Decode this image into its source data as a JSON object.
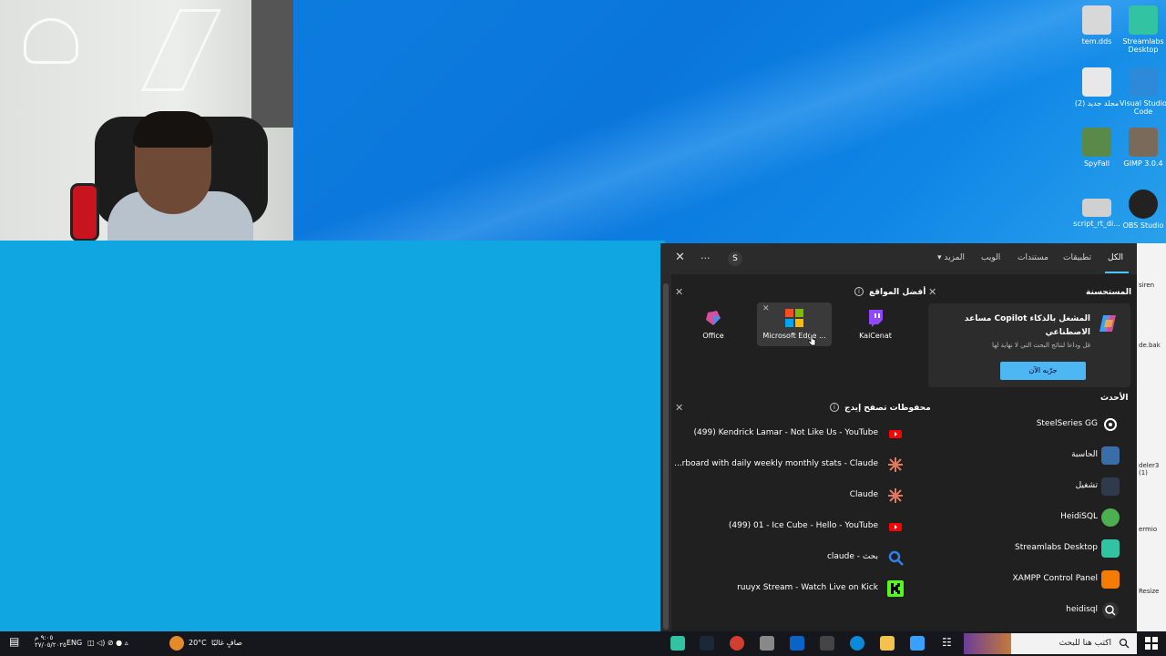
{
  "desktop_icons": [
    {
      "label": "tem.dds",
      "color": "#d8d8d8"
    },
    {
      "label": "Streamlabs Desktop",
      "color": "#31c3a2"
    },
    {
      "label": "مجلد جديد (2)",
      "color": "#e8e8e8"
    },
    {
      "label": "Visual Studio Code",
      "color": "#2c8ad9"
    },
    {
      "label": "SpyFall",
      "color": "#5a8a4a"
    },
    {
      "label": "GIMP 3.0.4",
      "color": "#7a6a5a"
    },
    {
      "label": "script_rt_di...",
      "color": "#d0d0d0"
    },
    {
      "label": "OBS Studio",
      "color": "#222222"
    }
  ],
  "right_strip_labels": [
    "siren",
    "de.bak",
    "deler3 (1)",
    "ermio",
    "Resize"
  ],
  "search": {
    "tabs": [
      "الكل",
      "تطبيقات",
      "مستندات",
      "الويب",
      "المزيد"
    ],
    "avatar_letter": "S",
    "more_label": "···",
    "close_label": "✕",
    "top_sites_title": "أفضل المواقع",
    "top_sites": [
      {
        "label": "Office",
        "icon": "office-icon"
      },
      {
        "label": "Microsoft Edge ...",
        "icon": "microsoft-icon"
      },
      {
        "label": "KaiCenat",
        "icon": "twitch-icon"
      }
    ],
    "history_title": "محفوظات تصفح إيدج",
    "history": [
      {
        "label": "(499) Kendrick Lamar - Not Like Us - YouTube",
        "icon": "youtube-icon"
      },
      {
        "label": "...rboard with daily weekly monthly stats - Claude",
        "icon": "claude-icon"
      },
      {
        "label": "Claude",
        "icon": "claude-icon"
      },
      {
        "label": "(499) 01 - Ice Cube - Hello - YouTube",
        "icon": "youtube-icon"
      },
      {
        "label": "claude - بحث",
        "icon": "search-icon"
      },
      {
        "label": "ruuyx Stream - Watch Live on Kick",
        "icon": "kick-icon"
      }
    ],
    "suggested_title": "المستحسنة",
    "copilot": {
      "title": "المشغل بالذكاء Copilot مساعد الاصطناعي",
      "subtitle": "قل وداعا لنتائج البحث التي لا نهاية لها",
      "button": "جرّبه الآن"
    },
    "recent_title": "الأحدث",
    "recent": [
      {
        "label": "SteelSeries GG",
        "icon": "steelseries-icon",
        "color": "#2a2a2a"
      },
      {
        "label": "الحاسبة",
        "icon": "calculator-icon",
        "color": "#3a6ea8"
      },
      {
        "label": "تشغيل",
        "icon": "run-icon",
        "color": "#2f3b4a"
      },
      {
        "label": "HeidiSQL",
        "icon": "heidisql-icon",
        "color": "#4caf50"
      },
      {
        "label": "Streamlabs Desktop",
        "icon": "streamlabs-icon",
        "color": "#31c3a2"
      },
      {
        "label": "XAMPP Control Panel",
        "icon": "xampp-icon",
        "color": "#f57c00"
      },
      {
        "label": "heidisql",
        "icon": "search-icon",
        "color": "#333333"
      }
    ]
  },
  "taskbar": {
    "search_placeholder": "اكتب هنا للبحث",
    "weather_temp": "20°C",
    "weather_text": "صافٍ غالبًا",
    "language": "ENG",
    "time": "٩:٠٥ م",
    "date": "٢٧/٠٥/٢٠٢٥"
  }
}
